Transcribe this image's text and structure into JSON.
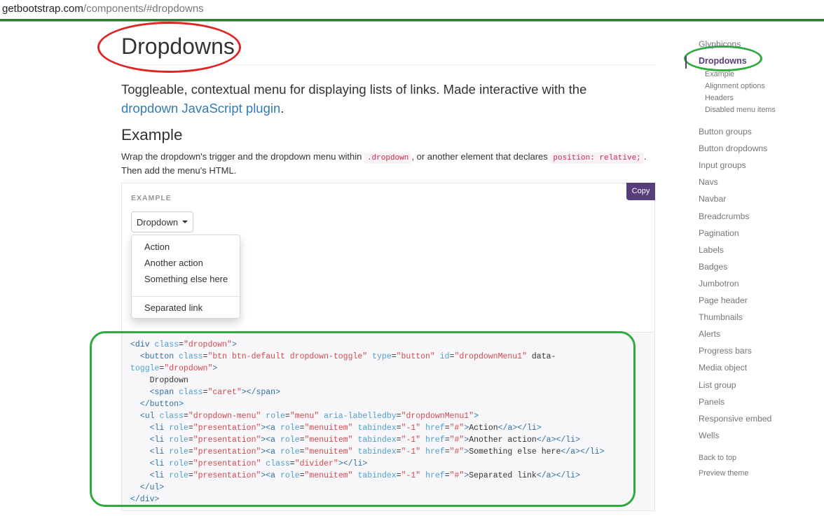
{
  "address_bar": {
    "url_host": "getbootstrap.com",
    "url_path": "/components/#dropdowns"
  },
  "main": {
    "title": "Dropdowns",
    "lead_text": "Toggleable, contextual menu for displaying lists of links. Made interactive with the ",
    "lead_link": "dropdown JavaScript plugin",
    "lead_end": ".",
    "section_heading": "Example",
    "para_part1": "Wrap the dropdown's trigger and the dropdown menu within ",
    "para_code1": ".dropdown",
    "para_part2": ", or another element that declares ",
    "para_code2": "position: relative;",
    "para_part3": ". Then add the menu's HTML."
  },
  "example": {
    "label": "EXAMPLE",
    "copy_label": "Copy",
    "dropdown_label": "Dropdown",
    "menu_items": [
      "Action",
      "Another action",
      "Something else here"
    ],
    "separated_item": "Separated link"
  },
  "code_lines": [
    "<div class=\"dropdown\">",
    "  <button class=\"btn btn-default dropdown-toggle\" type=\"button\" id=\"dropdownMenu1\" data-",
    "toggle=\"dropdown\">",
    "    Dropdown",
    "    <span class=\"caret\"></span>",
    "  </button>",
    "  <ul class=\"dropdown-menu\" role=\"menu\" aria-labelledby=\"dropdownMenu1\">",
    "    <li role=\"presentation\"><a role=\"menuitem\" tabindex=\"-1\" href=\"#\">Action</a></li>",
    "    <li role=\"presentation\"><a role=\"menuitem\" tabindex=\"-1\" href=\"#\">Another action</a></li>",
    "    <li role=\"presentation\"><a role=\"menuitem\" tabindex=\"-1\" href=\"#\">Something else here</a></li>",
    "    <li role=\"presentation\" class=\"divider\"></li>",
    "    <li role=\"presentation\"><a role=\"menuitem\" tabindex=\"-1\" href=\"#\">Separated link</a></li>",
    "  </ul>",
    "</div>"
  ],
  "sidebar": {
    "top_item": "Glyphicons",
    "active_item": "Dropdowns",
    "sub_items": [
      "Example",
      "Alignment options",
      "Headers",
      "Disabled menu items"
    ],
    "items": [
      "Button groups",
      "Button dropdowns",
      "Input groups",
      "Navs",
      "Navbar",
      "Breadcrumbs",
      "Pagination",
      "Labels",
      "Badges",
      "Jumbotron",
      "Page header",
      "Thumbnails",
      "Alerts",
      "Progress bars",
      "Media object",
      "List group",
      "Panels",
      "Responsive embed",
      "Wells"
    ],
    "back_to_top": "Back to top",
    "preview_theme": "Preview theme"
  },
  "colors": {
    "accent": "#563d7c",
    "link": "#337ab7",
    "annotation_red": "#e02424",
    "annotation_green": "#2eab3f"
  }
}
